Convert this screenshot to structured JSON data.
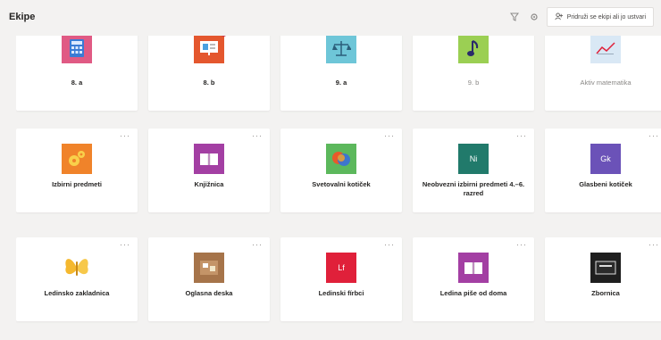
{
  "header": {
    "title": "Ekipe",
    "join_label": "Pridruži se ekipi ali jo ustvari"
  },
  "teams": [
    {
      "name": "8. a",
      "icon": "calculator-icon",
      "color": "#e05a84"
    },
    {
      "name": "8. b",
      "icon": "presentation-icon",
      "color": "#e4572e"
    },
    {
      "name": "9. a",
      "icon": "scales-icon",
      "color": "#6ec6d8"
    },
    {
      "name": "9. b",
      "icon": "music-note-icon",
      "color": "#9bcf53"
    },
    {
      "name": "Aktiv matematika",
      "icon": "line-chart-icon",
      "color": "#d9e8f5"
    },
    {
      "name": "Izbirni predmeti",
      "icon": "gears-icon",
      "color": "#f0832a"
    },
    {
      "name": "Knjižnica",
      "icon": "book-icon",
      "color": "#a33fa3"
    },
    {
      "name": "Svetovalni kotiček",
      "icon": "speech-bubbles-icon",
      "color": "#5cb85c"
    },
    {
      "name": "Neobvezni izbirni predmeti 4.–6. razred",
      "icon": "initials-icon",
      "initials": "Ni",
      "color": "#217a6b"
    },
    {
      "name": "Glasbeni kotiček",
      "icon": "initials-icon",
      "initials": "Gk",
      "color": "#6b52b8"
    },
    {
      "name": "Ledinsko zakladnica",
      "icon": "butterfly-icon",
      "color": "#f5b82e"
    },
    {
      "name": "Oglasna deska",
      "icon": "corkboard-icon",
      "color": "#a6744a"
    },
    {
      "name": "Ledinski fírbci",
      "icon": "initials-icon",
      "initials": "Lf",
      "color": "#e0203a"
    },
    {
      "name": "Ledina piše od doma",
      "icon": "book-icon",
      "color": "#a33fa3"
    },
    {
      "name": "Zbornica",
      "icon": "blackboard-icon",
      "color": "#1f1f1f"
    }
  ]
}
